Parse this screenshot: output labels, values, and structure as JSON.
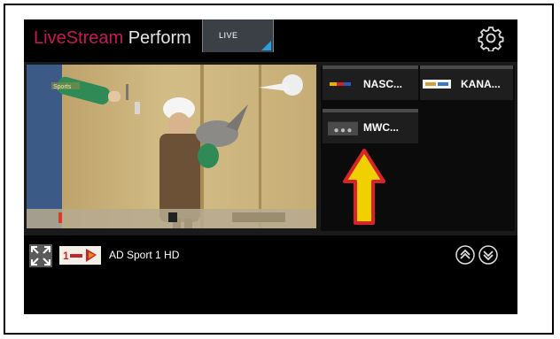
{
  "header": {
    "title_part1": "LiveStream",
    "title_part2": " Perform",
    "live_tab": "LIVE",
    "settings_icon": "gear-icon"
  },
  "player": {
    "overlay_text": "Sports"
  },
  "channels": [
    {
      "label": "NASC...",
      "logo": "nascar-logo"
    },
    {
      "label": "KANA...",
      "logo": "kanal-logo"
    },
    {
      "label": "MWC...",
      "logo": "placeholder-dots"
    }
  ],
  "now_playing": {
    "channel_name": "AD Sport 1 HD",
    "thumb_text": "1"
  },
  "colors": {
    "brand": "#c8185a",
    "accent": "#2a9fe0",
    "arrow_fill": "#f0d000",
    "arrow_stroke": "#d6242a"
  }
}
